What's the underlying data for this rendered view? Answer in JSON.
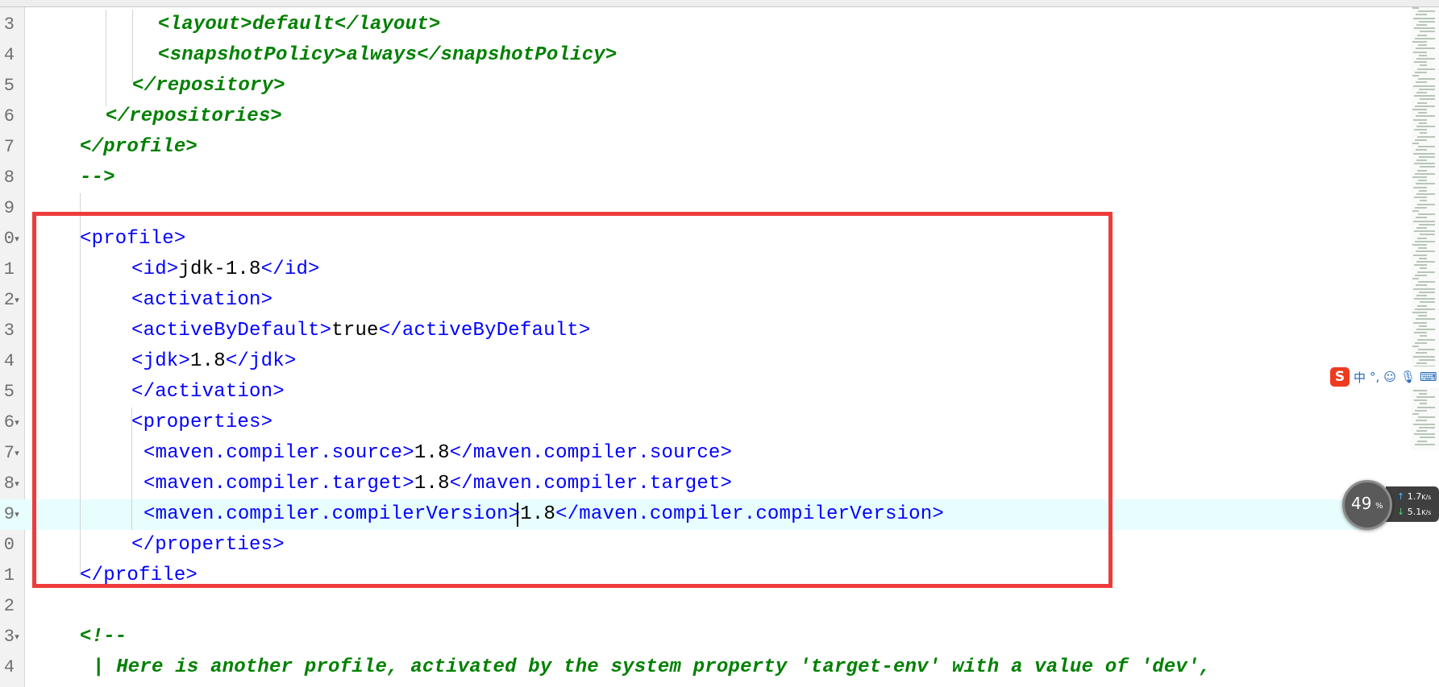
{
  "editor": {
    "lines": [
      {
        "num": "3",
        "fold": "",
        "segments": [
          {
            "t": "<layout>",
            "c": "cmt"
          },
          {
            "t": "default",
            "c": "cmt"
          },
          {
            "t": "</layout>",
            "c": "cmt"
          }
        ],
        "indent": 196
      },
      {
        "num": "4",
        "fold": "",
        "segments": [
          {
            "t": "<snapshotPolicy>",
            "c": "cmt"
          },
          {
            "t": "always",
            "c": "cmt"
          },
          {
            "t": "</snapshotPolicy>",
            "c": "cmt"
          }
        ],
        "indent": 196
      },
      {
        "num": "5",
        "fold": "",
        "segments": [
          {
            "t": "</repository>",
            "c": "cmt"
          }
        ],
        "indent": 164
      },
      {
        "num": "6",
        "fold": "",
        "segments": [
          {
            "t": "</repositories>",
            "c": "cmt"
          }
        ],
        "indent": 131
      },
      {
        "num": "7",
        "fold": "",
        "segments": [
          {
            "t": "</profile>",
            "c": "cmt"
          }
        ],
        "indent": 99
      },
      {
        "num": "8",
        "fold": "",
        "segments": [
          {
            "t": "-->",
            "c": "cmt"
          }
        ],
        "indent": 99
      },
      {
        "num": "9",
        "fold": "",
        "segments": [],
        "indent": 99
      },
      {
        "num": "0",
        "fold": "▾",
        "segments": [
          {
            "t": "<profile>",
            "c": "tag"
          }
        ],
        "indent": 99
      },
      {
        "num": "1",
        "fold": "",
        "segments": [
          {
            "t": "<id>",
            "c": "tag"
          },
          {
            "t": "jdk-1.8",
            "c": "txt"
          },
          {
            "t": "</id>",
            "c": "tag"
          }
        ],
        "indent": 163
      },
      {
        "num": "2",
        "fold": "▾",
        "segments": [
          {
            "t": "<activation>",
            "c": "tag"
          }
        ],
        "indent": 163
      },
      {
        "num": "3",
        "fold": "",
        "segments": [
          {
            "t": "<activeByDefault>",
            "c": "tag"
          },
          {
            "t": "true",
            "c": "txt"
          },
          {
            "t": "</activeByDefault>",
            "c": "tag"
          }
        ],
        "indent": 163
      },
      {
        "num": "4",
        "fold": "",
        "segments": [
          {
            "t": "<jdk>",
            "c": "tag"
          },
          {
            "t": "1.8",
            "c": "txt"
          },
          {
            "t": "</jdk>",
            "c": "tag"
          }
        ],
        "indent": 163
      },
      {
        "num": "5",
        "fold": "",
        "segments": [
          {
            "t": "</activation>",
            "c": "tag"
          }
        ],
        "indent": 163
      },
      {
        "num": "6",
        "fold": "▾",
        "segments": [
          {
            "t": "<properties>",
            "c": "tag"
          }
        ],
        "indent": 163
      },
      {
        "num": "7",
        "fold": "▾",
        "segments": [
          {
            "t": "<maven.compiler.source>",
            "c": "tag"
          },
          {
            "t": "1.8",
            "c": "txt"
          },
          {
            "t": "</maven.compiler.source>",
            "c": "tag"
          }
        ],
        "indent": 178
      },
      {
        "num": "8",
        "fold": "▾",
        "segments": [
          {
            "t": "<maven.compiler.target>",
            "c": "tag"
          },
          {
            "t": "1.8",
            "c": "txt"
          },
          {
            "t": "</maven.compiler.target>",
            "c": "tag"
          }
        ],
        "indent": 178
      },
      {
        "num": "9",
        "fold": "▾",
        "segments": [
          {
            "t": "<maven.compiler.compilerVersion>",
            "c": "tag"
          },
          {
            "t": "1.8",
            "c": "txt"
          },
          {
            "t": "</maven.compiler.compilerVersion>",
            "c": "tag"
          }
        ],
        "indent": 178,
        "current": true
      },
      {
        "num": "0",
        "fold": "",
        "segments": [
          {
            "t": "</properties>",
            "c": "tag"
          }
        ],
        "indent": 163
      },
      {
        "num": "1",
        "fold": "",
        "segments": [
          {
            "t": "</profile>",
            "c": "tag"
          }
        ],
        "indent": 99
      },
      {
        "num": "2",
        "fold": "",
        "segments": [],
        "indent": 99
      },
      {
        "num": "3",
        "fold": "▾",
        "segments": [
          {
            "t": "<!--",
            "c": "cmt"
          }
        ],
        "indent": 99
      },
      {
        "num": "4",
        "fold": "",
        "segments": [
          {
            "t": "| Here is another profile, activated by the system property 'target-env' with a value of 'dev',",
            "c": "cmt"
          }
        ],
        "indent": 115
      }
    ]
  },
  "ime": {
    "logo": "S",
    "mode": "中",
    "punct": "°,",
    "emoji_icon": "smiley-icon",
    "mic_icon": "microphone-icon",
    "keyboard_icon": "keyboard-icon"
  },
  "net_monitor": {
    "percent": "49",
    "percent_sign": "%",
    "upload": "1.7",
    "upload_unit": "K/s",
    "download": "5.1",
    "download_unit": "K/s",
    "up_color": "#4fb4ff",
    "down_color": "#4fd86b"
  },
  "colors": {
    "tag": "#0000ff",
    "text": "#000000",
    "comment": "#008000",
    "highlight_box": "#ee3b3b",
    "current_line": "#e8fdfe"
  }
}
